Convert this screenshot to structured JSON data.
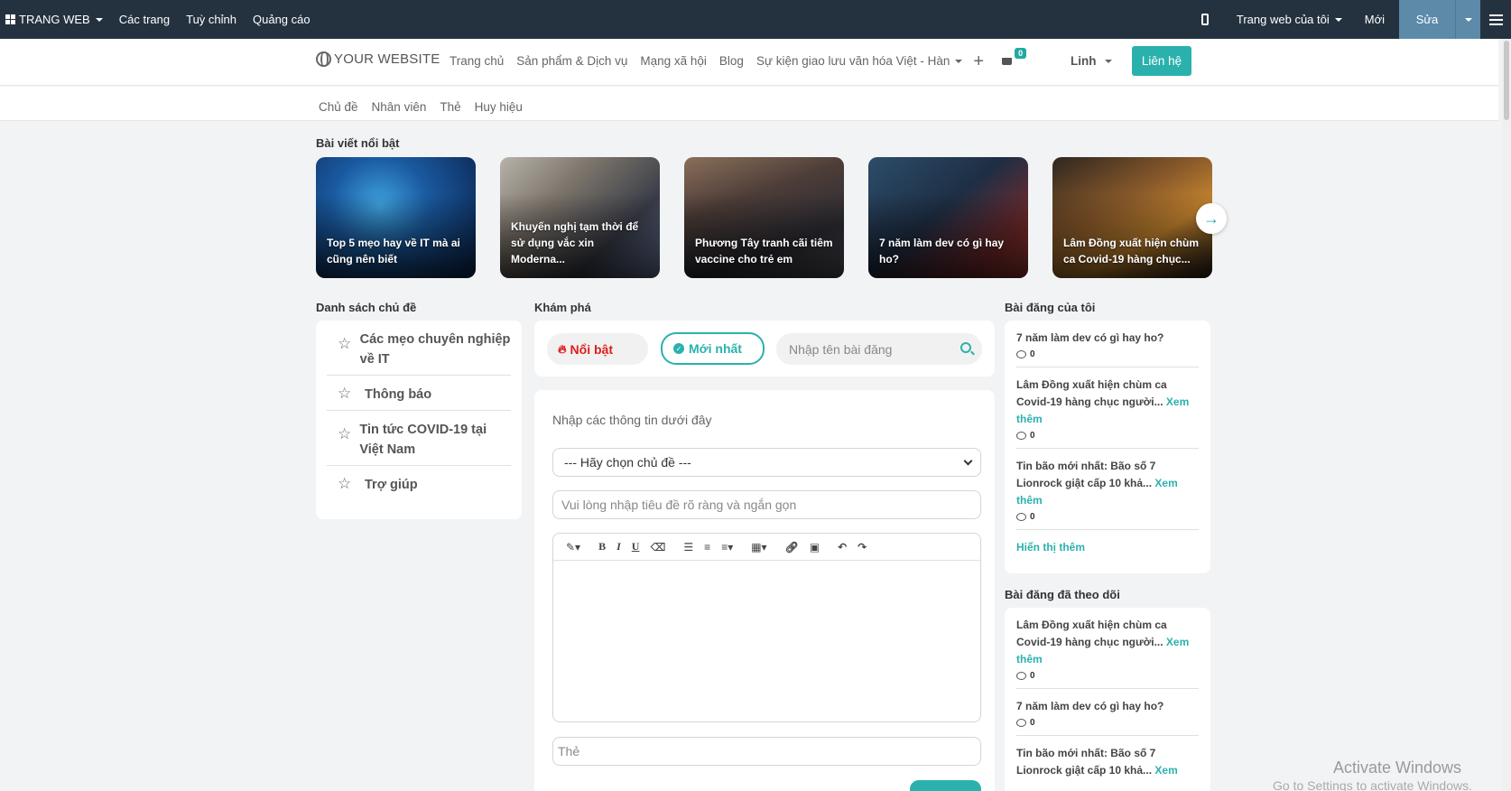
{
  "adminbar": {
    "brand": "TRANG WEB",
    "menu": [
      "Các trang",
      "Tuỳ chỉnh",
      "Quảng cáo"
    ],
    "my_site": "Trang web của tôi",
    "new": "Mới",
    "edit": "Sửa"
  },
  "header": {
    "logo": "YOUR WEBSITE",
    "nav": [
      "Trang chủ",
      "Sản phẩm & Dịch vụ",
      "Mạng xã hội",
      "Blog",
      "Sự kiện giao lưu văn hóa Việt - Hàn"
    ],
    "cart_count": "0",
    "user": "Linh",
    "contact": "Liên hệ"
  },
  "subnav": [
    "Chủ đề",
    "Nhân viên",
    "Thẻ",
    "Huy hiệu"
  ],
  "featured": {
    "title": "Bài viết nổi bật",
    "cards": [
      "Top 5 mẹo hay về IT mà ai cũng nên biết",
      "Khuyến nghị tạm thời để sử dụng vắc xin Moderna...",
      "Phương Tây tranh cãi tiêm vaccine cho trẻ em",
      "7 năm làm dev có gì hay ho?",
      "Lâm Đồng xuất hiện chùm ca Covid-19 hàng chục..."
    ]
  },
  "topics": {
    "title": "Danh sách chủ đề",
    "items": [
      "Các mẹo chuyên nghiệp về IT",
      "Thông báo",
      "Tin tức COVID-19 tại Việt Nam",
      "Trợ giúp"
    ]
  },
  "explore": {
    "title": "Khám phá",
    "tab_hot": "Nổi bật",
    "tab_new": "Mới nhất",
    "search_placeholder": "Nhập tên bài đăng",
    "form_hint": "Nhập các thông tin dưới đây",
    "select_topic": "--- Hãy chọn chủ đề ---",
    "title_placeholder": "Vui lòng nhập tiêu đề rõ ràng và ngắn gọn",
    "tags_placeholder": "Thẻ"
  },
  "my_posts": {
    "title": "Bài đăng của tôi",
    "posts": [
      {
        "title": "7 năm làm dev có gì hay ho?",
        "more": "",
        "comments": "0"
      },
      {
        "title": "Lâm Đồng xuất hiện chùm ca Covid-19 hàng chục người...",
        "more": "Xem thêm",
        "comments": "0"
      },
      {
        "title": "Tin bão mới nhất: Bão số 7 Lionrock giật cấp 10 khả...",
        "more": "Xem thêm",
        "comments": "0"
      }
    ],
    "show_more": "Hiển thị thêm"
  },
  "followed_posts": {
    "title": "Bài đăng đã theo dõi",
    "posts": [
      {
        "title": "Lâm Đồng xuất hiện chùm ca Covid-19 hàng chục người...",
        "more": "Xem thêm",
        "comments": "0"
      },
      {
        "title": "7 năm làm dev có gì hay ho?",
        "more": "",
        "comments": "0"
      },
      {
        "title": "Tin bão mới nhất: Bão số 7 Lionrock giật cấp 10 khả...",
        "more": "Xem",
        "comments": ""
      }
    ]
  },
  "watermark": {
    "line1": "Activate Windows",
    "line2": "Go to Settings to activate Windows."
  },
  "colors": {
    "accent": "#2bb1ad",
    "adminbar": "#243240",
    "hot": "#e21b1b"
  }
}
